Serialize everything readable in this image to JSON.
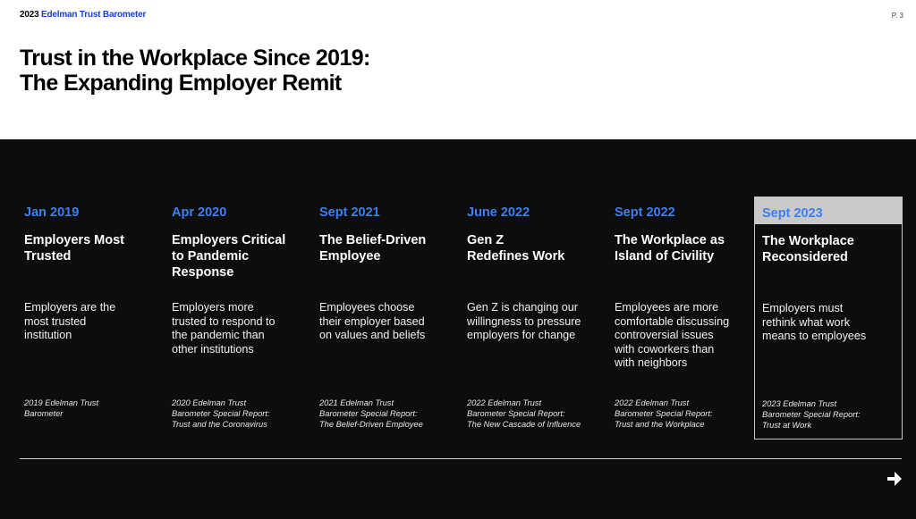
{
  "header": {
    "year": "2023",
    "brand": "Edelman Trust Barometer",
    "page": "P. 3"
  },
  "title": {
    "line1": "Trust in the Workplace Since 2019:",
    "line2": "The Expanding Employer Remit"
  },
  "timeline": [
    {
      "date": "Jan 2019",
      "heading": [
        "Employers Most",
        "Trusted"
      ],
      "description": [
        "Employers are the",
        "most trusted",
        "institution"
      ],
      "source": [
        "2019 Edelman Trust",
        "Barometer"
      ]
    },
    {
      "date": "Apr 2020",
      "heading": [
        "Employers Critical",
        "to Pandemic",
        "Response"
      ],
      "description": [
        "Employers more",
        "trusted to respond to",
        "the pandemic than",
        "other institutions"
      ],
      "source": [
        "2020 Edelman Trust",
        "Barometer Special Report:",
        "Trust and the Coronavirus"
      ]
    },
    {
      "date": "Sept 2021",
      "heading": [
        "The Belief-Driven",
        "Employee"
      ],
      "description": [
        "Employees choose",
        "their employer based",
        "on values and beliefs"
      ],
      "source": [
        "2021 Edelman Trust",
        "Barometer Special Report:",
        "The Belief-Driven Employee"
      ]
    },
    {
      "date": "June 2022",
      "heading": [
        "Gen Z",
        "Redefines Work"
      ],
      "description": [
        "Gen Z is changing our",
        "willingness to pressure",
        "employers for change"
      ],
      "source": [
        "2022 Edelman Trust",
        "Barometer Special Report:",
        "The New Cascade of Influence"
      ]
    },
    {
      "date": "Sept 2022",
      "heading": [
        "The Workplace as",
        "Island of Civility"
      ],
      "description": [
        "Employees are more",
        "comfortable discussing",
        "controversial issues",
        "with coworkers than",
        "with neighbors"
      ],
      "source": [
        "2022 Edelman Trust",
        "Barometer Special Report:",
        "Trust and the Workplace"
      ]
    },
    {
      "date": "Sept 2023",
      "heading": [
        "The Workplace",
        "Reconsidered"
      ],
      "description": [
        "Employers must",
        "rethink what work",
        "means to employees"
      ],
      "source": [
        "2023 Edelman Trust",
        "Barometer Special Report:",
        "Trust at Work"
      ]
    }
  ],
  "colors": {
    "accent_blue": "#3d7ff0",
    "brand_blue": "#1a3fd6",
    "panel_bg": "#0d0d0d",
    "highlight_band": "#c9c9c9"
  },
  "icons": {
    "next": "arrow-down-right-icon"
  }
}
